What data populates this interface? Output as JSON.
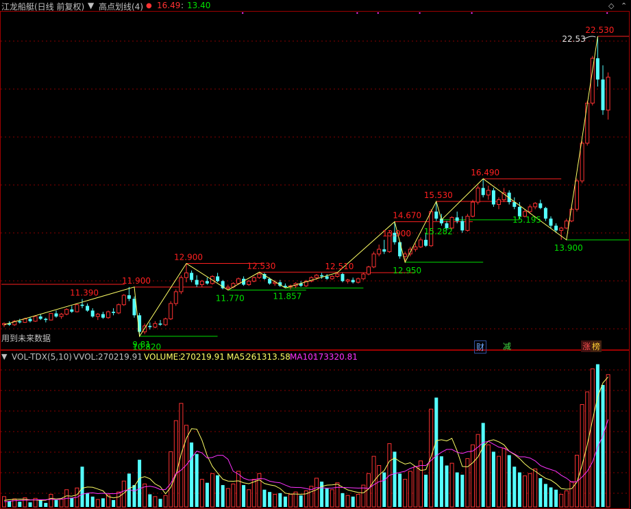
{
  "header": {
    "title": "江龙船艇(日线 前复权)",
    "indicator": "高点划线(4)",
    "val_red": "16.49",
    "val_sep": ":",
    "val_green": "13.40"
  },
  "colors": {
    "up": "#ff3232",
    "down": "#54ffff",
    "zigzag": "#ffff66",
    "high_line": "#ff2020",
    "low_line": "#00e000",
    "ma5": "#ffff66",
    "ma10": "#ff33ff",
    "grid": "#8b0000"
  },
  "future_note": "用到未来数据",
  "events": [
    "财",
    "减",
    "涨",
    "榜"
  ],
  "price_labels": {
    "highs": [
      "11.390",
      "11.900",
      "12.900",
      "12.530",
      "12.510",
      "13.900",
      "14.670",
      "15.530",
      "16.490",
      "22.530"
    ],
    "lows": [
      "9.81",
      "10.820",
      "11.770",
      "11.857",
      "12.950",
      "15.282",
      "15.195",
      "13.900"
    ],
    "arrow_label": "22.53"
  },
  "volume_legend": {
    "name": "VOL-TDX(5,10)",
    "vvol_label": "VVOL:",
    "vvol_value": "270219.91",
    "volume_label": "VOLUME:",
    "volume_value": "270219.91",
    "ma5_label": "MA5:",
    "ma5_value": "261313.58",
    "ma10_label": "MA10:",
    "ma10_value": "173320.81"
  },
  "chart_data": [
    {
      "type": "candlestick",
      "title": "江龙船艇(日线 前复权)",
      "xlabel": "",
      "ylabel": "",
      "ylim": [
        9.4,
        23.2
      ],
      "grid": true,
      "candles": [
        [
          10.3,
          10.4,
          10.2,
          10.35
        ],
        [
          10.35,
          10.45,
          10.25,
          10.3
        ],
        [
          10.3,
          10.5,
          10.25,
          10.45
        ],
        [
          10.45,
          10.55,
          10.35,
          10.4
        ],
        [
          10.4,
          10.6,
          10.38,
          10.55
        ],
        [
          10.55,
          10.62,
          10.4,
          10.45
        ],
        [
          10.45,
          10.7,
          10.42,
          10.65
        ],
        [
          10.65,
          10.75,
          10.5,
          10.55
        ],
        [
          10.55,
          10.6,
          10.4,
          10.5
        ],
        [
          10.5,
          10.8,
          10.48,
          10.78
        ],
        [
          10.78,
          10.9,
          10.6,
          10.65
        ],
        [
          10.65,
          10.8,
          10.55,
          10.75
        ],
        [
          10.75,
          11.0,
          10.7,
          10.95
        ],
        [
          10.95,
          11.1,
          10.8,
          10.85
        ],
        [
          10.85,
          11.2,
          10.82,
          11.15
        ],
        [
          11.15,
          11.39,
          11.0,
          11.1
        ],
        [
          11.1,
          11.2,
          10.85,
          10.9
        ],
        [
          10.9,
          11.0,
          10.6,
          10.65
        ],
        [
          10.65,
          10.8,
          10.5,
          10.75
        ],
        [
          10.75,
          10.85,
          10.55,
          10.6
        ],
        [
          10.6,
          10.9,
          10.55,
          10.85
        ],
        [
          10.85,
          11.0,
          10.7,
          10.8
        ],
        [
          10.8,
          11.2,
          10.75,
          11.15
        ],
        [
          11.15,
          11.6,
          11.1,
          11.55
        ],
        [
          11.55,
          11.9,
          11.3,
          11.4
        ],
        [
          11.4,
          11.5,
          10.6,
          10.7
        ],
        [
          10.7,
          10.8,
          9.81,
          10.0
        ],
        [
          10.0,
          10.35,
          9.9,
          10.25
        ],
        [
          10.25,
          10.4,
          10.1,
          10.2
        ],
        [
          10.2,
          10.45,
          10.15,
          10.35
        ],
        [
          10.35,
          10.5,
          10.25,
          10.3
        ],
        [
          10.3,
          10.6,
          10.25,
          10.55
        ],
        [
          10.55,
          11.3,
          10.5,
          11.2
        ],
        [
          11.2,
          11.8,
          11.1,
          11.7
        ],
        [
          11.7,
          12.4,
          11.6,
          12.3
        ],
        [
          12.3,
          12.9,
          12.1,
          12.5
        ],
        [
          12.5,
          12.6,
          12.1,
          12.2
        ],
        [
          12.2,
          12.4,
          11.9,
          12.0
        ],
        [
          12.0,
          12.2,
          11.9,
          12.15
        ],
        [
          12.15,
          12.3,
          12.0,
          12.05
        ],
        [
          12.05,
          12.4,
          12.0,
          12.35
        ],
        [
          12.35,
          12.5,
          12.1,
          12.15
        ],
        [
          12.15,
          12.2,
          11.8,
          11.85
        ],
        [
          11.85,
          12.0,
          11.77,
          11.9
        ],
        [
          11.9,
          12.1,
          11.85,
          12.05
        ],
        [
          12.05,
          12.3,
          12.0,
          12.25
        ],
        [
          12.25,
          12.35,
          11.95,
          12.0
        ],
        [
          12.0,
          12.2,
          11.95,
          12.15
        ],
        [
          12.15,
          12.35,
          12.1,
          12.3
        ],
        [
          12.3,
          12.53,
          12.25,
          12.45
        ],
        [
          12.45,
          12.5,
          12.2,
          12.25
        ],
        [
          12.25,
          12.3,
          12.0,
          12.05
        ],
        [
          12.05,
          12.2,
          11.95,
          12.1
        ],
        [
          12.1,
          12.2,
          11.9,
          11.95
        ],
        [
          11.95,
          12.05,
          11.86,
          11.9
        ],
        [
          11.9,
          12.0,
          11.8,
          11.95
        ],
        [
          11.95,
          12.1,
          11.85,
          12.05
        ],
        [
          12.05,
          12.15,
          11.9,
          11.95
        ],
        [
          11.95,
          12.2,
          11.9,
          12.15
        ],
        [
          12.15,
          12.35,
          12.1,
          12.3
        ],
        [
          12.3,
          12.45,
          12.2,
          12.4
        ],
        [
          12.4,
          12.5,
          12.25,
          12.35
        ],
        [
          12.35,
          12.45,
          12.2,
          12.25
        ],
        [
          12.25,
          12.4,
          12.2,
          12.35
        ],
        [
          12.35,
          12.51,
          12.3,
          12.45
        ],
        [
          12.45,
          12.5,
          12.1,
          12.15
        ],
        [
          12.15,
          12.25,
          12.05,
          12.2
        ],
        [
          12.2,
          12.3,
          12.05,
          12.1
        ],
        [
          12.1,
          12.3,
          12.05,
          12.25
        ],
        [
          12.25,
          12.5,
          12.2,
          12.45
        ],
        [
          12.45,
          12.8,
          12.4,
          12.75
        ],
        [
          12.75,
          13.4,
          12.7,
          13.3
        ],
        [
          13.3,
          13.7,
          13.2,
          13.5
        ],
        [
          13.5,
          13.9,
          13.3,
          13.4
        ],
        [
          13.4,
          14.3,
          13.35,
          14.2
        ],
        [
          14.2,
          14.67,
          13.7,
          13.8
        ],
        [
          13.8,
          13.85,
          13.1,
          13.2
        ],
        [
          13.2,
          13.4,
          12.95,
          13.3
        ],
        [
          13.3,
          13.6,
          13.2,
          13.5
        ],
        [
          13.5,
          13.75,
          13.4,
          13.6
        ],
        [
          13.6,
          14.0,
          13.55,
          13.9
        ],
        [
          13.9,
          14.2,
          13.6,
          13.65
        ],
        [
          13.65,
          15.2,
          13.6,
          15.1
        ],
        [
          15.1,
          15.53,
          14.7,
          14.8
        ],
        [
          14.8,
          15.0,
          14.5,
          14.6
        ],
        [
          14.6,
          14.7,
          14.3,
          14.4
        ],
        [
          14.4,
          14.9,
          14.35,
          14.85
        ],
        [
          14.85,
          15.1,
          14.6,
          14.7
        ],
        [
          14.7,
          14.9,
          14.2,
          14.3
        ],
        [
          14.3,
          15.0,
          14.25,
          14.9
        ],
        [
          14.9,
          15.6,
          14.85,
          15.5
        ],
        [
          15.5,
          16.2,
          15.4,
          16.1
        ],
        [
          16.1,
          16.49,
          15.7,
          15.8
        ],
        [
          15.8,
          16.2,
          15.6,
          16.0
        ],
        [
          16.0,
          16.1,
          15.3,
          15.4
        ],
        [
          15.4,
          15.7,
          15.2,
          15.6
        ],
        [
          15.6,
          16.1,
          15.5,
          15.9
        ],
        [
          15.9,
          16.0,
          15.4,
          15.5
        ],
        [
          15.5,
          15.7,
          15.2,
          15.3
        ],
        [
          15.3,
          15.5,
          14.8,
          14.9
        ],
        [
          14.9,
          15.2,
          14.85,
          15.1
        ],
        [
          15.1,
          15.4,
          15.0,
          15.3
        ],
        [
          15.3,
          15.5,
          15.2,
          15.45
        ],
        [
          15.45,
          15.6,
          15.2,
          15.25
        ],
        [
          15.25,
          15.3,
          14.7,
          14.8
        ],
        [
          14.8,
          14.9,
          14.4,
          14.5
        ],
        [
          14.5,
          14.6,
          14.2,
          14.3
        ],
        [
          14.3,
          14.45,
          13.9,
          14.4
        ],
        [
          14.4,
          14.8,
          14.35,
          14.7
        ],
        [
          14.7,
          15.3,
          14.65,
          15.2
        ],
        [
          15.2,
          16.5,
          15.1,
          16.4
        ],
        [
          16.4,
          18.1,
          16.3,
          18.0
        ],
        [
          18.0,
          19.8,
          17.9,
          19.7
        ],
        [
          19.7,
          21.7,
          19.6,
          21.6
        ],
        [
          21.6,
          22.53,
          20.4,
          20.7
        ],
        [
          20.7,
          21.3,
          19.2,
          19.4
        ],
        [
          19.4,
          21.0,
          19.0,
          20.8
        ]
      ],
      "zigzag_points": [
        [
          0,
          10.3
        ],
        [
          25,
          11.9
        ],
        [
          26,
          9.81
        ],
        [
          35,
          12.9
        ],
        [
          43,
          11.77
        ],
        [
          49,
          12.53
        ],
        [
          54,
          11.86
        ],
        [
          64,
          12.51
        ],
        [
          75,
          14.67
        ],
        [
          77,
          12.95
        ],
        [
          83,
          15.53
        ],
        [
          84,
          14.75
        ],
        [
          92,
          16.49
        ],
        [
          108,
          13.9
        ],
        [
          114,
          22.53
        ]
      ]
    },
    {
      "type": "bar",
      "title": "VOL-TDX(5,10)",
      "series": [
        {
          "name": "VOLUME",
          "values": [
            18000,
            10000,
            14000,
            9000,
            16000,
            8000,
            15000,
            13000,
            7000,
            22000,
            12000,
            14000,
            30000,
            16000,
            33000,
            70000,
            24000,
            18000,
            13000,
            15000,
            21000,
            12000,
            26000,
            45000,
            58000,
            38000,
            82000,
            40000,
            22000,
            18000,
            14000,
            20000,
            96000,
            150000,
            180000,
            142000,
            112000,
            92000,
            48000,
            42000,
            58000,
            55000,
            38000,
            32000,
            40000,
            62000,
            38000,
            30000,
            48000,
            58000,
            30000,
            26000,
            22000,
            24000,
            18000,
            22000,
            26000,
            20000,
            28000,
            36000,
            50000,
            44000,
            32000,
            30000,
            42000,
            24000,
            20000,
            18000,
            22000,
            38000,
            58000,
            88000,
            72000,
            60000,
            110000,
            96000,
            58000,
            48000,
            62000,
            70000,
            80000,
            56000,
            170000,
            190000,
            88000,
            72000,
            76000,
            60000,
            56000,
            84000,
            108000,
            126000,
            146000,
            108000,
            96000,
            88000,
            102000,
            90000,
            70000,
            60000,
            54000,
            58000,
            66000,
            50000,
            40000,
            34000,
            30000,
            22000,
            28000,
            44000,
            90000,
            178000,
            200000,
            240000,
            248000,
            212000,
            230000
          ]
        },
        {
          "name": "MA5",
          "values": [
            11400,
            12600,
            13200,
            13500,
            13400,
            12400,
            12200,
            11400,
            11800,
            15000,
            13800,
            14800,
            19400,
            18800,
            21000,
            32600,
            34600,
            34200,
            31200,
            28000,
            18000,
            15800,
            17400,
            23800,
            32400,
            35800,
            49800,
            52600,
            49000,
            40000,
            35200,
            22800,
            34000,
            55600,
            92000,
            119200,
            136000,
            135200,
            116000,
            89000,
            70400,
            59000,
            48200,
            45000,
            44600,
            45400,
            42000,
            40400,
            43600,
            47200,
            40800,
            38400,
            36800,
            32000,
            24000,
            22400,
            22400,
            22000,
            22800,
            26400,
            30000,
            35600,
            38000,
            38400,
            39600,
            34400,
            29600,
            27200,
            25200,
            24400,
            31200,
            44800,
            55600,
            63200,
            79600,
            85200,
            78800,
            74400,
            76800,
            70400,
            63600,
            64800,
            87600,
            115200,
            116800,
            114800,
            119200,
            97200,
            70400,
            69600,
            76800,
            86800,
            104400,
            114400,
            116800,
            113200,
            108000,
            96800,
            91200,
            84000,
            74800,
            67400,
            62200,
            55600,
            49800,
            46600,
            40400,
            32000,
            30800,
            31600,
            43000,
            72400,
            108000,
            151000,
            191600,
            215600,
            226000
          ]
        },
        {
          "name": "MA10",
          "values": [
            9000,
            10000,
            11000,
            11500,
            11800,
            12000,
            12300,
            12500,
            12600,
            13200,
            13000,
            13400,
            15000,
            15500,
            16800,
            22200,
            24000,
            24600,
            23200,
            23800,
            23400,
            23000,
            23800,
            27800,
            30200,
            27400,
            31600,
            35000,
            36000,
            34200,
            30200,
            30200,
            40600,
            58000,
            64000,
            73000,
            85000,
            97000,
            94000,
            85000,
            86000,
            89800,
            89800,
            82800,
            62000,
            57000,
            50000,
            46800,
            47000,
            49600,
            48800,
            44800,
            43000,
            42000,
            38000,
            34400,
            34000,
            33800,
            32000,
            30000,
            33600,
            33400,
            32600,
            32800,
            34200,
            34000,
            33600,
            33200,
            32800,
            33000,
            32200,
            38600,
            44000,
            46000,
            55000,
            58000,
            60000,
            62000,
            67000,
            70000,
            72000,
            72000,
            81000,
            89000,
            95000,
            100000,
            100000,
            95000,
            93000,
            96000,
            97000,
            104000,
            112000,
            114000,
            109000,
            104000,
            102000,
            97000,
            92000,
            87000,
            87000,
            85000,
            80000,
            72000,
            68000,
            65000,
            62000,
            55000,
            50000,
            43000,
            44000,
            52000,
            62000,
            78000,
            104000,
            124000,
            152000
          ]
        }
      ]
    }
  ]
}
